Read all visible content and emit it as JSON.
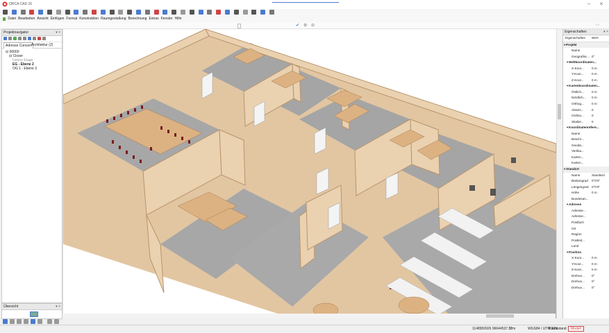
{
  "window": {
    "title": "ORCA CAD 16",
    "minimize_glyph": "–",
    "close_glyph": "×"
  },
  "toolbar_icons": [
    "new-icon",
    "save-icon",
    "open-icon",
    "copy-icon",
    "print-icon",
    "undo-icon",
    "redo-icon",
    "pointer-icon",
    "select-icon",
    "zoom-icon",
    "zoom-window-icon",
    "pan-icon",
    "move-icon",
    "rotate-icon",
    "mirror-icon",
    "array-icon",
    "measure-icon",
    "snap-icon",
    "grid-icon",
    "wall-icon",
    "door-icon",
    "window-icon",
    "stair-icon",
    "room-icon",
    "text-icon",
    "dimension-icon",
    "layer-icon",
    "view-3d-icon",
    "render-icon",
    "settings-icon",
    "help-icon"
  ],
  "menu": [
    "Datei",
    "Bearbeiten",
    "Ansicht",
    "Einfügen",
    "Format",
    "Konstruktion",
    "Raumgestaltung",
    "Berechnung",
    "Extras",
    "Fenster",
    "Hilfe"
  ],
  "project_navigator": {
    "title": "Projektnavigator",
    "tabs": [
      "Adresse Concert",
      "Architektur (2)"
    ],
    "tree": [
      {
        "label": "⊟ 00000",
        "indent": 1
      },
      {
        "label": "⊟ Closer",
        "indent": 2
      },
      {
        "label": "Untere Etage",
        "indent": 3,
        "muted": true
      },
      {
        "label": "EG - Ebene 2",
        "indent": 3,
        "bold": true
      },
      {
        "label": "OG 1 - Ebene 3",
        "indent": 3
      }
    ]
  },
  "overview": {
    "title": "Übersicht"
  },
  "properties": {
    "title": "Eigenschaften",
    "col_key": "Eigenschaften",
    "col_val": "Wert",
    "rows": [
      {
        "type": "sec",
        "k": "Projekt"
      },
      {
        "k": "Name",
        "v": ""
      },
      {
        "k": "Geografisc...",
        "v": "0°"
      },
      {
        "type": "sub",
        "k": "Weltkoordinaten..."
      },
      {
        "k": "X-Koor...",
        "v": "0 m"
      },
      {
        "k": "Y-Koor...",
        "v": "0 m"
      },
      {
        "k": "Z-Koor...",
        "v": "0 m"
      },
      {
        "type": "sub",
        "k": "Kartenkoordinaten..."
      },
      {
        "k": "Östlich...",
        "v": "0 m"
      },
      {
        "k": "Nördlich...",
        "v": "0 m"
      },
      {
        "k": "Orthog...",
        "v": "0 m"
      },
      {
        "k": "Abszis...",
        "v": "0"
      },
      {
        "k": "Ordina...",
        "v": "0"
      },
      {
        "k": "Skalier...",
        "v": "0"
      },
      {
        "type": "sub",
        "k": "Koordinatenrefere..."
      },
      {
        "k": "Name",
        "v": ""
      },
      {
        "k": "Beschr...",
        "v": ""
      },
      {
        "k": "Geodä...",
        "v": ""
      },
      {
        "k": "Vertika...",
        "v": ""
      },
      {
        "k": "Karten...",
        "v": ""
      },
      {
        "k": "Karten...",
        "v": ""
      },
      {
        "type": "sec",
        "k": "Standort"
      },
      {
        "k": "Name",
        "v": "Standard"
      },
      {
        "k": "Breitengrad",
        "v": "0°0'0\""
      },
      {
        "k": "Längengrad",
        "v": "0°0'0\""
      },
      {
        "k": "Höhe",
        "v": "0 m"
      },
      {
        "k": "Bundesan...",
        "v": ""
      },
      {
        "type": "sub",
        "k": "Adresse"
      },
      {
        "k": "Adresse...",
        "v": ""
      },
      {
        "k": "Adresse...",
        "v": ""
      },
      {
        "k": "Postfach",
        "v": ""
      },
      {
        "k": "Ort",
        "v": ""
      },
      {
        "k": "Region",
        "v": ""
      },
      {
        "k": "Postleit...",
        "v": ""
      },
      {
        "k": "Land",
        "v": ""
      },
      {
        "type": "sub",
        "k": "Position"
      },
      {
        "k": "X-Koor...",
        "v": "0 m"
      },
      {
        "k": "Y-Koor...",
        "v": "0 m"
      },
      {
        "k": "Z-Koor...",
        "v": "0 m"
      },
      {
        "k": "Drehun...",
        "v": "0°"
      },
      {
        "k": "Drehun...",
        "v": "0°"
      },
      {
        "k": "Drehun...",
        "v": "0°"
      }
    ]
  },
  "statusbar": {
    "coords": "1148950926 96644537.52",
    "dim": "0 m",
    "crs": "WGS84 / UTM 32N",
    "layer": "Raumstand",
    "mode": "Modell"
  },
  "colors": {
    "wall": "#e8c9a4",
    "floor": "#a3a3a3",
    "accent": "#4a7bd0",
    "chair": "#7a1c1c"
  }
}
